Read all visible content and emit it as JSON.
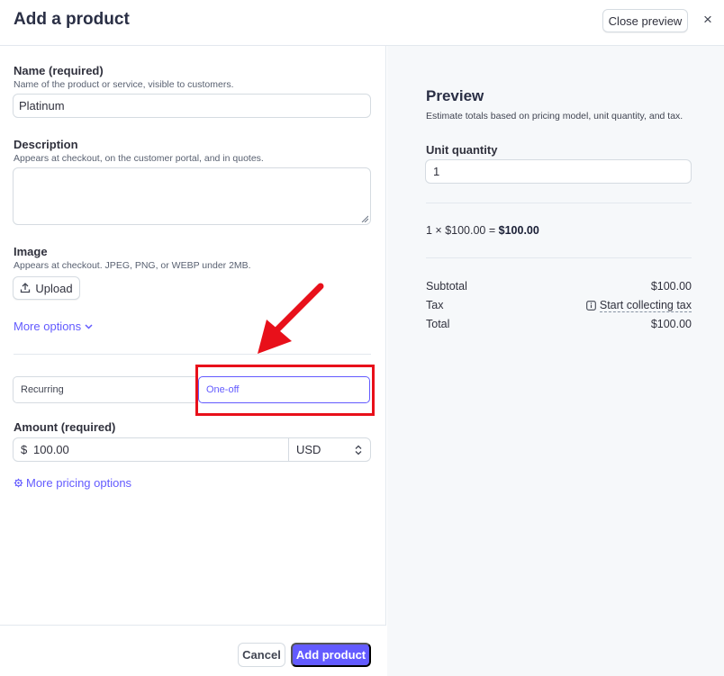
{
  "header": {
    "title": "Add a product",
    "close_preview_label": "Close preview",
    "close_icon": "×"
  },
  "form": {
    "name": {
      "label": "Name (required)",
      "hint": "Name of the product or service, visible to customers.",
      "value": "Platinum"
    },
    "description": {
      "label": "Description",
      "hint": "Appears at checkout, on the customer portal, and in quotes.",
      "value": ""
    },
    "image": {
      "label": "Image",
      "hint": "Appears at checkout. JPEG, PNG, or WEBP under 2MB.",
      "upload_label": "Upload"
    },
    "more_options_label": "More options",
    "pricing_type": {
      "options": [
        "Recurring",
        "One-off"
      ],
      "selected": "One-off"
    },
    "amount": {
      "label": "Amount (required)",
      "currency_symbol": "$",
      "value": "100.00",
      "currency": "USD"
    },
    "more_pricing_label": "More pricing options"
  },
  "footer": {
    "cancel_label": "Cancel",
    "add_label": "Add product"
  },
  "preview": {
    "title": "Preview",
    "subtitle": "Estimate totals based on pricing model, unit quantity, and tax.",
    "unit_quantity_label": "Unit quantity",
    "unit_quantity_value": "1",
    "calc_prefix": "1 × $100.00 = ",
    "calc_result": "$100.00",
    "subtotal_label": "Subtotal",
    "subtotal_value": "$100.00",
    "tax_label": "Tax",
    "tax_link": "Start collecting tax",
    "total_label": "Total",
    "total_value": "$100.00"
  },
  "colors": {
    "accent": "#635bff",
    "annotation": "#e8101a"
  }
}
